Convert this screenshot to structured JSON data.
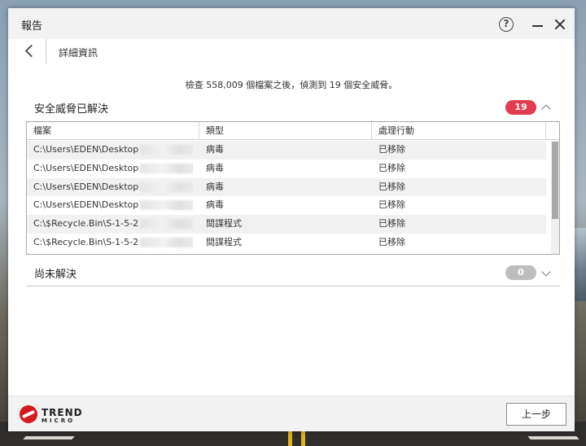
{
  "window": {
    "title": "報告"
  },
  "nav": {
    "title": "詳細資訊"
  },
  "summary": "檢查 558,009 個檔案之後，偵測到 19 個安全威脅。",
  "resolved_section": {
    "title": "安全威脅已解決",
    "count": "19",
    "columns": [
      "檔案",
      "類型",
      "處理行動"
    ],
    "rows": [
      {
        "file": "C:\\Users\\EDEN\\Desktop",
        "type": "病毒",
        "action": "已移除"
      },
      {
        "file": "C:\\Users\\EDEN\\Desktop",
        "type": "病毒",
        "action": "已移除"
      },
      {
        "file": "C:\\Users\\EDEN\\Desktop",
        "type": "病毒",
        "action": "已移除"
      },
      {
        "file": "C:\\Users\\EDEN\\Desktop",
        "type": "病毒",
        "action": "已移除"
      },
      {
        "file": "C:\\$Recycle.Bin\\S-1-5-2",
        "type": "間諜程式",
        "action": "已移除"
      },
      {
        "file": "C:\\$Recycle.Bin\\S-1-5-2",
        "type": "間諜程式",
        "action": "已移除"
      }
    ],
    "ellipsis": "..."
  },
  "unresolved_section": {
    "title": "尚未解決",
    "count": "0"
  },
  "footer": {
    "brand_line1": "TREND",
    "brand_line2": "MICRO",
    "back_button": "上一步"
  },
  "colors": {
    "badge_red": "#e43c50",
    "badge_gray": "#bdbdbd",
    "brand_red": "#d71920"
  },
  "icons": {
    "help": "help-icon",
    "minimize": "minimize-icon",
    "close": "close-icon",
    "back": "back-arrow-icon",
    "expand_up": "chevron-up-icon",
    "expand_down": "chevron-down-icon",
    "logo": "trend-micro-logo-icon"
  }
}
